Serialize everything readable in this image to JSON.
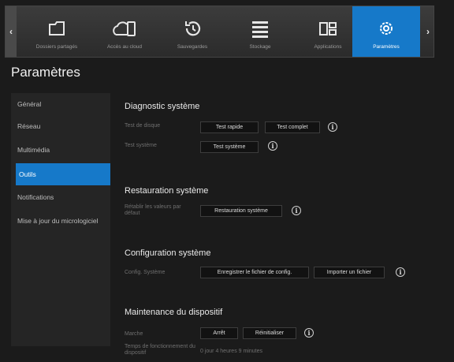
{
  "nav": {
    "prev": "‹",
    "next": "›",
    "items": [
      {
        "label": "Dossiers partagés",
        "icon": "shared-folder-icon"
      },
      {
        "label": "Accès au cloud",
        "icon": "cloud-device-icon"
      },
      {
        "label": "Sauvegardes",
        "icon": "backup-clock-icon"
      },
      {
        "label": "Stockage",
        "icon": "storage-stack-icon"
      },
      {
        "label": "Applications",
        "icon": "apps-grid-icon"
      },
      {
        "label": "Paramètres",
        "icon": "gear-icon"
      }
    ],
    "active_index": 5,
    "accent": "#1679c9"
  },
  "page_title": "Paramètres",
  "sidebar": {
    "items": [
      {
        "label": "Général"
      },
      {
        "label": "Réseau"
      },
      {
        "label": "Multimédia"
      },
      {
        "label": "Outils"
      },
      {
        "label": "Notifications"
      },
      {
        "label": "Mise à jour du micrologiciel"
      }
    ],
    "active_index": 3
  },
  "main": {
    "diagnostic": {
      "title": "Diagnostic système",
      "disk_test_label": "Test de disque",
      "quick_test": "Test rapide",
      "full_test": "Test complet",
      "system_test_label": "Test système",
      "system_test": "Test système"
    },
    "restore": {
      "title": "Restauration système",
      "label": "Rétablir les valeurs par défaut",
      "button": "Restauration système"
    },
    "config": {
      "title": "Configuration système",
      "label": "Config. Système",
      "save": "Enregistrer le fichier de config.",
      "import": "Importer un fichier"
    },
    "maintenance": {
      "title": "Maintenance du dispositif",
      "power_label": "Marche",
      "stop": "Arrêt",
      "reset": "Réinitialiser",
      "uptime_label": "Temps de fonctionnement du dispositif",
      "uptime_value": "0 jour 4 heures 9 minutes"
    }
  }
}
